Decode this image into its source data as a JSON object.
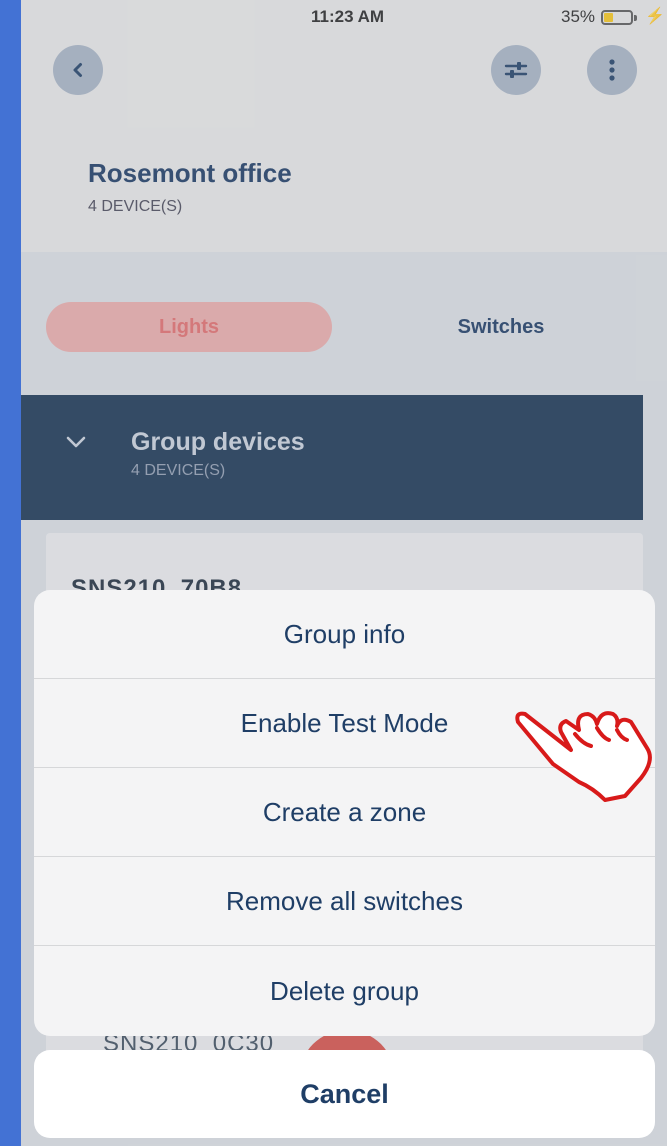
{
  "status_bar": {
    "time": "11:23 AM",
    "battery_percent": "35%",
    "battery_level": 0.35,
    "charging_icon": "bolt-icon"
  },
  "header": {
    "back_icon": "chevron-left-icon",
    "filter_icon": "sliders-icon",
    "more_icon": "more-vertical-icon",
    "group_title": "Rosemont office",
    "group_device_count": "4 DEVICE(S)"
  },
  "tabs": [
    {
      "label": "Lights",
      "selected": true
    },
    {
      "label": "Switches",
      "selected": false
    }
  ],
  "group_devices": {
    "title": "Group devices",
    "count": "4 DEVICE(S)",
    "chevron_icon": "chevron-down-icon"
  },
  "devices": [
    "SNS210_70B8",
    "SNS210_0C30"
  ],
  "action_sheet": {
    "items": [
      {
        "label": "Group info"
      },
      {
        "label": "Enable Test Mode"
      },
      {
        "label": "Create a zone"
      },
      {
        "label": "Remove all switches"
      },
      {
        "label": "Delete group"
      }
    ],
    "cancel_label": "Cancel"
  },
  "pointer_icon": "pointing-hand-icon",
  "colors": {
    "navy": "#14304f",
    "accent_red": "#e06a6a",
    "text_blue": "#1f3e66",
    "frame_blue": "#4372d4"
  }
}
